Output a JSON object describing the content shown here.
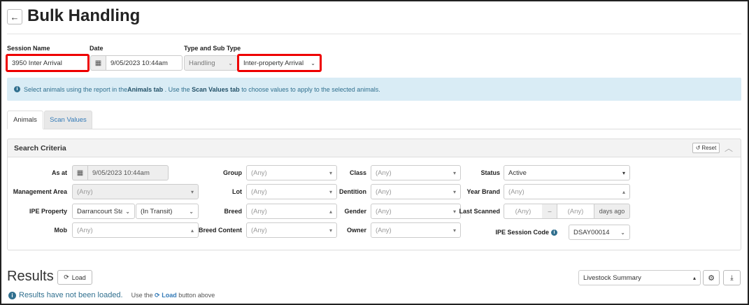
{
  "header": {
    "title": "Bulk Handling",
    "back_icon": "arrow-left-icon"
  },
  "session": {
    "name_label": "Session Name",
    "name_value": "3950 Inter Arrival",
    "date_label": "Date",
    "date_value": "9/05/2023 10:44am",
    "type_label": "Type and Sub Type",
    "type_value": "Handling",
    "subtype_value": "Inter-property Arrival"
  },
  "info": {
    "text_1": "Select animals using the report in the ",
    "bold_1": "Animals tab",
    "text_2": " . Use the ",
    "bold_2": "Scan Values tab",
    "text_3": " to choose values to apply to the selected animals."
  },
  "tabs": [
    {
      "label": "Animals",
      "active": true
    },
    {
      "label": "Scan Values",
      "active": false
    }
  ],
  "search": {
    "title": "Search Criteria",
    "reset_label": "Reset",
    "as_at_label": "As at",
    "as_at_value": "9/05/2023 10:44am",
    "management_area_label": "Management Area",
    "management_area_value": "(Any)",
    "ipe_property_label": "IPE Property",
    "ipe_property_value": "Darrancourt Sta",
    "ipe_property_state": "(In Transit)",
    "mob_label": "Mob",
    "mob_value": "(Any)",
    "group_label": "Group",
    "group_value": "(Any)",
    "lot_label": "Lot",
    "lot_value": "(Any)",
    "breed_label": "Breed",
    "breed_value": "(Any)",
    "breed_content_label": "Breed Content",
    "breed_content_value": "(Any)",
    "class_label": "Class",
    "class_value": "(Any)",
    "dentition_label": "Dentition",
    "dentition_value": "(Any)",
    "gender_label": "Gender",
    "gender_value": "(Any)",
    "owner_label": "Owner",
    "owner_value": "(Any)",
    "status_label": "Status",
    "status_value": "Active",
    "year_brand_label": "Year Brand",
    "year_brand_value": "(Any)",
    "last_scanned_label": "Last Scanned",
    "last_scanned_from": "(Any)",
    "last_scanned_sep": "–",
    "last_scanned_to": "(Any)",
    "last_scanned_suffix": "days ago",
    "ipe_session_code_label": "IPE Session Code",
    "ipe_session_code_value": "DSAY00014"
  },
  "results": {
    "title": "Results",
    "load_label": "Load",
    "report_value": "Livestock Summary",
    "status_text": "Results have not been loaded.",
    "hint_prefix": "Use the",
    "hint_button": "Load",
    "hint_suffix": "button above"
  },
  "colors": {
    "highlight": "#e00000",
    "info_bg": "#d9ecf5",
    "link": "#337ab7"
  }
}
